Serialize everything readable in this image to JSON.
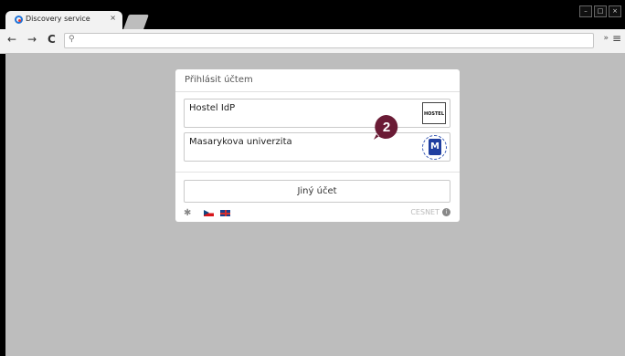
{
  "browser": {
    "tab_title": "Discovery service",
    "tab_close": "×",
    "window_buttons": [
      "–",
      "□",
      "×"
    ],
    "address": "",
    "nav": {
      "back": "←",
      "forward": "→",
      "reload": "C"
    },
    "menu": "≡",
    "chevron": "»"
  },
  "dialog": {
    "title": "Přihlásit účtem",
    "accounts": [
      {
        "label": "Hostel IdP",
        "logo_text": "HOSTEL"
      },
      {
        "label": "Masarykova univerzita",
        "logo_text": "MU"
      }
    ],
    "other_button": "Jiný účet",
    "footer": {
      "provider": "CESNET"
    }
  },
  "overlay": {
    "step": "2",
    "color": "#6a1b35"
  },
  "colors": {
    "background": "#bdbdbd",
    "card": "#ffffff",
    "tab": "#f2f2f2"
  }
}
